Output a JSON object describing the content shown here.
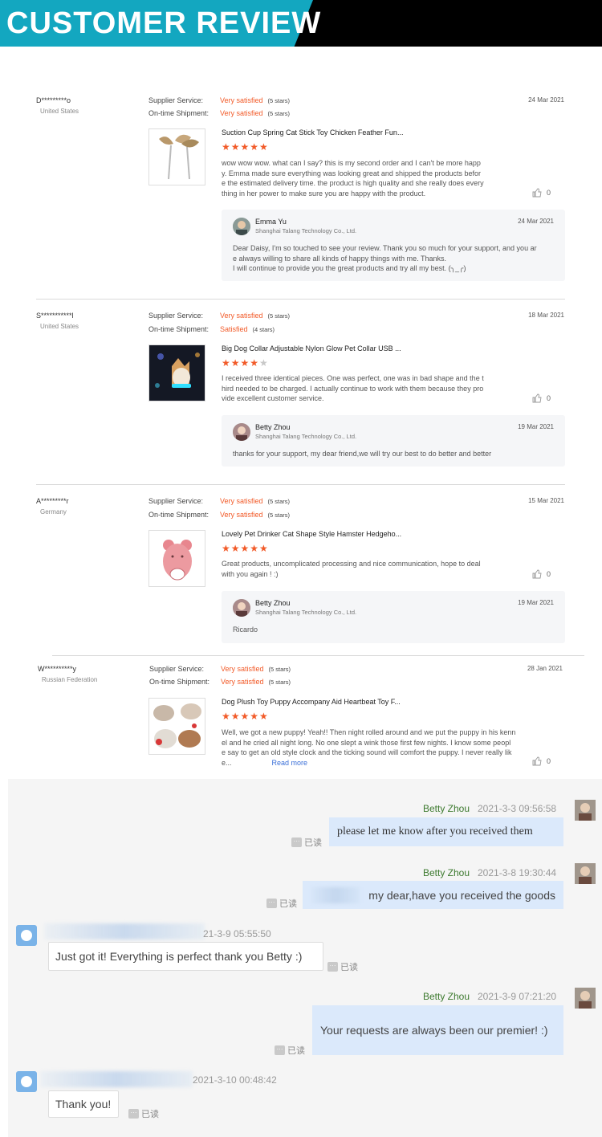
{
  "banner": {
    "title": "CUSTOMER REVIEW",
    "colors": {
      "accent": "#13a7c0",
      "background": "#000000"
    }
  },
  "labels": {
    "supplier_service": "Supplier Service:",
    "ontime_shipment": "On-time Shipment:",
    "read_more": "Read more"
  },
  "reviews": [
    {
      "buyer": "D*********o",
      "country": "United States",
      "date": "24 Mar 2021",
      "supplier_service": "Very satisfied",
      "supplier_stars": "(5 stars)",
      "shipment": "Very satisfied",
      "shipment_stars": "(5 stars)",
      "product": "Suction Cup Spring Cat Stick Toy Chicken Feather Fun...",
      "rating": 5,
      "text_lines": [
        "wow wow wow. what can I say? this is my second order and I can't be more happ",
        "y. Emma made sure everything was looking great and shipped the products befor",
        "e the estimated delivery time. the product is high quality and she really does every",
        "thing in her power to make sure you are happy with the product."
      ],
      "likes": "0",
      "reply": {
        "name": "Emma Yu",
        "company": "Shanghai Talang Technology Co., Ltd.",
        "date": "24 Mar 2021",
        "lines": [
          "Dear Daisy, I'm so touched to see your review. Thank you so much for your support, and you ar",
          "e always willing to share all kinds of happy things with me. Thanks.",
          "I will continue to provide you the great products and try all my best. (╮_╭)"
        ]
      }
    },
    {
      "buyer": "S***********l",
      "country": "United States",
      "date": "18 Mar 2021",
      "supplier_service": "Very satisfied",
      "supplier_stars": "(5 stars)",
      "shipment": "Satisfied",
      "shipment_stars": "(4 stars)",
      "product": "Big Dog Collar Adjustable Nylon Glow Pet Collar USB ...",
      "rating": 4,
      "text_lines": [
        "I received three identical pieces. One was perfect, one was in bad shape and the t",
        "hird needed to be charged. I actually continue to work with them because they pro",
        "vide excellent customer service."
      ],
      "likes": "0",
      "reply": {
        "name": "Betty Zhou",
        "company": "Shanghai Talang Technology Co., Ltd.",
        "date": "19 Mar 2021",
        "lines": [
          "thanks for your support, my dear friend,we will try our best to do better and better"
        ]
      }
    },
    {
      "buyer": "A*********r",
      "country": "Germany",
      "date": "15 Mar 2021",
      "supplier_service": "Very satisfied",
      "supplier_stars": "(5 stars)",
      "shipment": "Very satisfied",
      "shipment_stars": "(5 stars)",
      "product": "Lovely Pet Drinker Cat Shape Style Hamster Hedgeho...",
      "rating": 5,
      "text_lines": [
        "Great products, uncomplicated processing and nice communication, hope to deal",
        "with you again ! :)"
      ],
      "likes": "0",
      "reply": {
        "name": "Betty Zhou",
        "company": "Shanghai Talang Technology Co., Ltd.",
        "date": "19 Mar 2021",
        "lines": [
          "Ricardo"
        ]
      }
    },
    {
      "buyer": "W**********y",
      "country": "Russian Federation",
      "date": "28 Jan 2021",
      "supplier_service": "Very satisfied",
      "supplier_stars": "(5 stars)",
      "shipment": "Very satisfied",
      "shipment_stars": "(5 stars)",
      "product": "Dog Plush Toy Puppy Accompany Aid Heartbeat Toy F...",
      "rating": 5,
      "text_lines": [
        "Well, we got a new puppy! Yeah!! Then night rolled around and we put the puppy in his kenn",
        "el and he cried all night long. No one slept a wink those first few nights. I know some peopl",
        "e say to get an old style clock and the ticking sound will comfort the puppy. I never really lik",
        "e..."
      ],
      "likes": "0"
    }
  ],
  "chat": {
    "read_label": "已读",
    "messages": [
      {
        "sender": "Betty Zhou",
        "time": "2021-3-3 09:56:58",
        "text": "please let me know after you received them"
      },
      {
        "sender": "Betty Zhou",
        "time": "2021-3-8 19:30:44",
        "text": "my dear,have you received the goods"
      },
      {
        "time": "21-3-9 05:55:50",
        "text": "Just got it! Everything is perfect thank you Betty :)"
      },
      {
        "sender": "Betty Zhou",
        "time": "2021-3-9 07:21:20",
        "text": "Your requests are always been our premier! :)"
      },
      {
        "time": "2021-3-10 00:48:42",
        "text": "Thank you!"
      }
    ]
  }
}
